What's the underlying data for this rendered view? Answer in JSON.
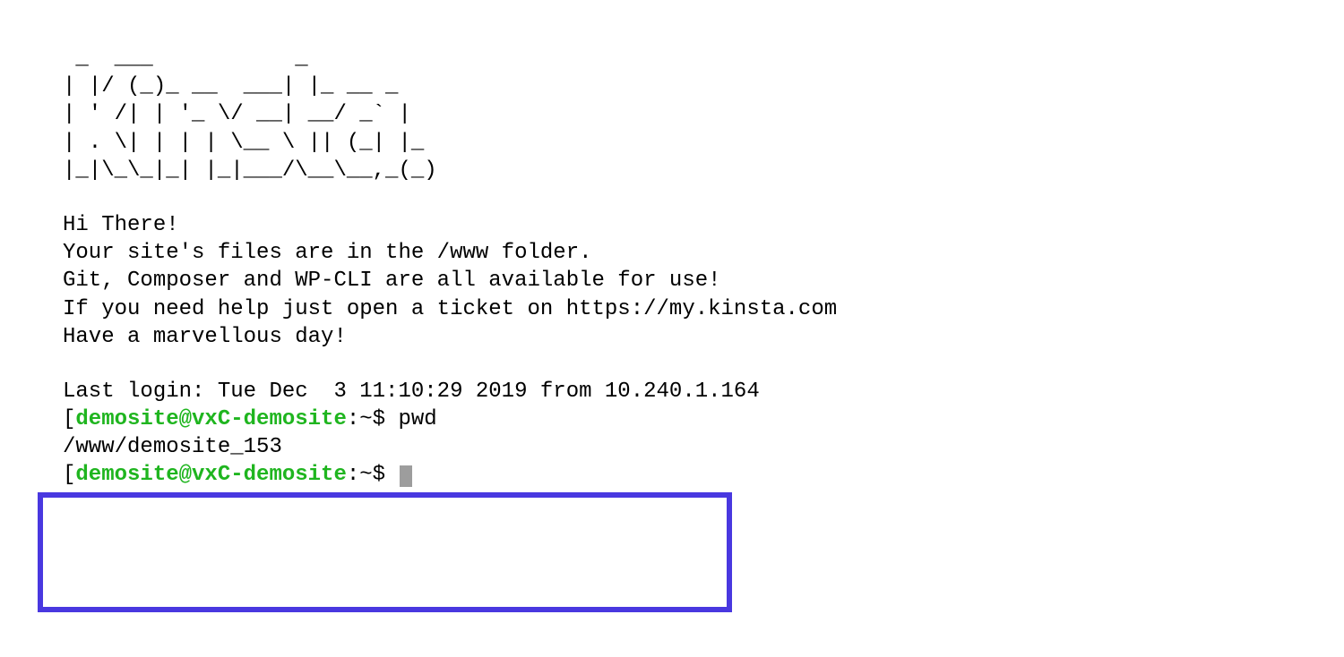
{
  "ascii_art": " _  ___           _\n| |/ (_)_ __  ___| |_ __ _\n| ' /| | '_ \\/ __| __/ _` |\n| . \\| | | | \\__ \\ || (_| |_\n|_|\\_\\_|_| |_|___/\\__\\__,_(_)",
  "motd": {
    "line1": "Hi There!",
    "line2": "Your site's files are in the /www folder.",
    "line3": "Git, Composer and WP-CLI are all available for use!",
    "line4": "If you need help just open a ticket on https://my.kinsta.com",
    "line5": "Have a marvellous day!"
  },
  "last_login": {
    "prefix": "Last login: ",
    "date": "Tue Dec  3 11:10:29 2019",
    "from_text": " from ",
    "ip": "10.240.1.164"
  },
  "prompt1": {
    "bracket": "[",
    "user_host": "demosite@vxC-demosite",
    "colon": ":",
    "path": "~",
    "dollar": "$ ",
    "command": "pwd"
  },
  "output1": "/www/demosite_153",
  "prompt2": {
    "bracket": "[",
    "user_host": "demosite@vxC-demosite",
    "colon": ":",
    "path": "~",
    "dollar": "$ "
  },
  "colors": {
    "prompt_green": "#1fb51f",
    "highlight_border": "#4938e0",
    "text": "#000000",
    "cursor": "#9d9d9d"
  }
}
